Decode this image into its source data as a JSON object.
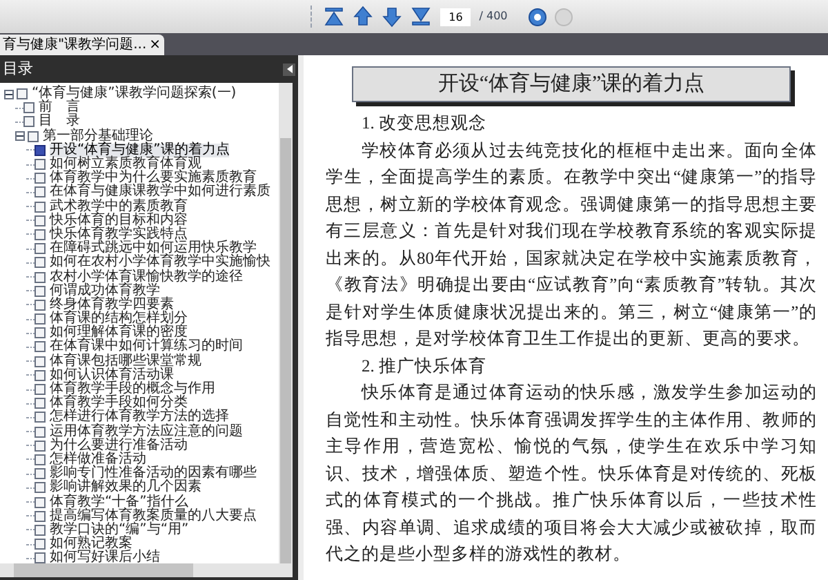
{
  "toolbar": {
    "page": "16",
    "total": "/ 400"
  },
  "tab": {
    "title": "育与健康\"课教学问题...",
    "close": "×"
  },
  "sidebar": {
    "title": "目录",
    "tree": [
      {
        "label": "“体育与健康”课教学问题探索(一)",
        "expanded": true,
        "selected": false,
        "children": [
          {
            "label": "前　言",
            "selected": false
          },
          {
            "label": "目　录",
            "selected": false
          },
          {
            "label": "第一部分基础理论",
            "expanded": true,
            "selected": false,
            "children": [
              {
                "label": "开设“体育与健康”课的着力点",
                "selected": true
              },
              {
                "label": "如何树立素质教育体育观",
                "selected": false
              },
              {
                "label": "体育教学中为什么要实施素质教育",
                "selected": false
              },
              {
                "label": "在体育与健康课教学中如何进行素质",
                "selected": false
              },
              {
                "label": "武术教学中的素质教育",
                "selected": false
              },
              {
                "label": "快乐体育的目标和内容",
                "selected": false
              },
              {
                "label": "快乐体育教学实践特点",
                "selected": false
              },
              {
                "label": "在障碍式跳远中如何运用快乐教学",
                "selected": false
              },
              {
                "label": "如何在农村小学体育教学中实施愉快",
                "selected": false
              },
              {
                "label": "农村小学体育课愉快教学的途径",
                "selected": false
              },
              {
                "label": "何谓成功体育教学",
                "selected": false
              },
              {
                "label": "终身体育教学四要素",
                "selected": false
              },
              {
                "label": "体育课的结构怎样划分",
                "selected": false
              },
              {
                "label": "如何理解体育课的密度",
                "selected": false
              },
              {
                "label": "在体育课中如何计算练习的时间",
                "selected": false
              },
              {
                "label": "体育课包括哪些课堂常规",
                "selected": false
              },
              {
                "label": "如何认识体育活动课",
                "selected": false
              },
              {
                "label": "体育教学手段的概念与作用",
                "selected": false
              },
              {
                "label": "体育教学手段如何分类",
                "selected": false
              },
              {
                "label": "怎样进行体育教学方法的选择",
                "selected": false
              },
              {
                "label": "运用体育教学方法应注意的问题",
                "selected": false
              },
              {
                "label": "为什么要进行准备活动",
                "selected": false
              },
              {
                "label": "怎样做准备活动",
                "selected": false
              },
              {
                "label": "影响专门性准备活动的因素有哪些",
                "selected": false
              },
              {
                "label": "影响讲解效果的几个因素",
                "selected": false
              },
              {
                "label": "体育教学“十备”指什么",
                "selected": false
              },
              {
                "label": "提高编写体育教案质量的八大要点",
                "selected": false
              },
              {
                "label": "教学口诀的“编”与“用”",
                "selected": false
              },
              {
                "label": "如何熟记教案",
                "selected": false
              },
              {
                "label": "如何写好课后小结",
                "selected": false
              }
            ]
          }
        ]
      }
    ]
  },
  "document": {
    "title": "开设“体育与健康”课的着力点",
    "blocks": [
      {
        "kind": "heading",
        "text": "1. 改变思想观念"
      },
      {
        "kind": "paragraph",
        "text": "学校体育必须从过去纯竞技化的框框中走出来。面向全体学生，全面提高学生的素质。在教学中突出“健康第一”的指导思想，树立新的学校体育观念。强调健康第一的指导思想主要有三层意义：首先是针对我们现在学校教育系统的客观实际提出来的。从80年代开始，国家就决定在学校中实施素质教育，《教育法》明确提出要由“应试教育”向“素质教育”转轨。其次是针对学生体质健康状况提出来的。第三，树立“健康第一”的指导思想，是对学校体育卫生工作提出的更新、更高的要求。"
      },
      {
        "kind": "heading",
        "text": "2. 推广快乐体育"
      },
      {
        "kind": "paragraph",
        "text": "快乐体育是通过体育运动的快乐感，激发学生参加运动的自觉性和主动性。快乐体育强调发挥学生的主体作用、教师的主导作用，营造宽松、愉悦的气氛，使学生在欢乐中学习知识、技术，增强体质、塑造个性。快乐体育是对传统的、死板式的体育模式的一个挑战。推广快乐体育以后，一些技术性强、内容单调、追求成绩的项目将会大大减少或被砍掉，取而代之的是些小型多样的游戏性的教材。"
      }
    ]
  }
}
